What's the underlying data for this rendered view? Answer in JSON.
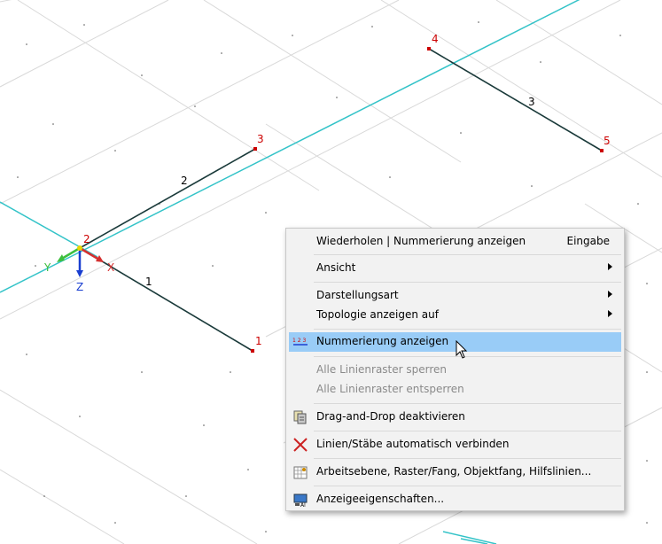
{
  "viewport": {
    "node_labels": [
      "1",
      "2",
      "3",
      "4",
      "5"
    ],
    "line_labels": [
      "1",
      "2",
      "3"
    ],
    "axes": {
      "x": "X",
      "y": "Y",
      "z": "Z"
    },
    "colors": {
      "node": "#cc0000",
      "line": "#1a3a3a",
      "grid_line": "#33c3c8",
      "grid": "#d6d6d6"
    }
  },
  "context_menu": {
    "items": [
      {
        "label": "Wiederholen | Nummerierung anzeigen",
        "shortcut": "Eingabe"
      },
      {
        "label": "Ansicht",
        "submenu": true
      },
      {
        "label": "Darstellungsart",
        "submenu": true
      },
      {
        "label": "Topologie anzeigen auf",
        "submenu": true
      },
      {
        "label": "Nummerierung anzeigen",
        "icon": "numbering-icon",
        "highlighted": true
      },
      {
        "label": "Alle Linienraster sperren",
        "disabled": true
      },
      {
        "label": "Alle Linienraster entsperren",
        "disabled": true
      },
      {
        "label": "Drag-and-Drop deaktivieren",
        "icon": "drag-drop-icon"
      },
      {
        "label": "Linien/Stäbe automatisch verbinden",
        "icon": "connect-lines-icon"
      },
      {
        "label": "Arbeitsebene, Raster/Fang, Objektfang, Hilfslinien...",
        "icon": "grid-snap-icon"
      },
      {
        "label": "Anzeigeeigenschaften...",
        "icon": "display-properties-icon"
      }
    ],
    "highlight_color": "#99ccf7"
  }
}
